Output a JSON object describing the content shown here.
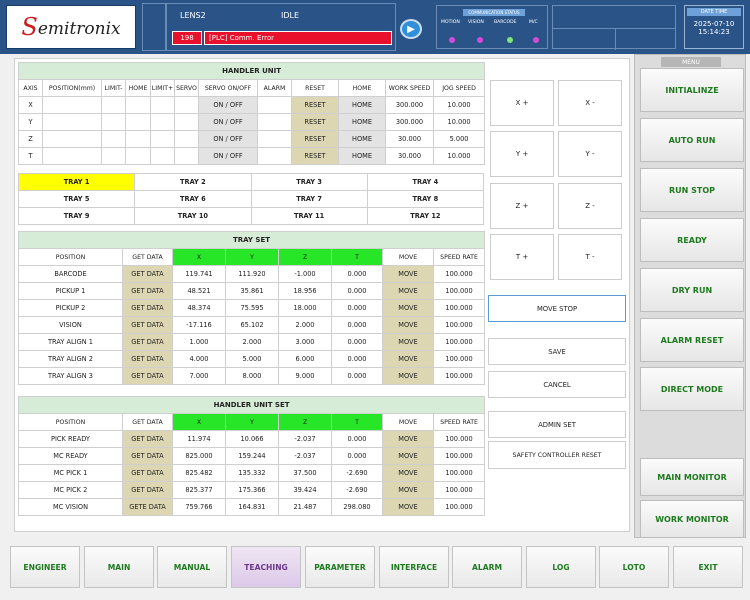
{
  "header": {
    "logo_text": "Semitronix",
    "lens": "LENS2",
    "state": "IDLE",
    "error_code": "198",
    "error_message": "[PLC] Comm. Error",
    "comm_title": "COMMUNICATION STATUS",
    "comm_items": [
      {
        "label": "MOTION",
        "color": "#d84bd8"
      },
      {
        "label": "VISION",
        "color": "#d84bd8"
      },
      {
        "label": "BARCODE",
        "color": "#7fe37f"
      },
      {
        "label": "M/C",
        "color": "#d84bd8"
      }
    ],
    "datetime_title": "DATE TIME",
    "date": "2025-07-10",
    "time": "15:14:23"
  },
  "handler_unit": {
    "title": "HANDLER UNIT",
    "columns": [
      "AXIS",
      "POSITION(mm)",
      "LIMIT-",
      "HOME",
      "LIMIT+",
      "SERVO",
      "SERVO ON/OFF",
      "ALARM",
      "RESET",
      "HOME",
      "WORK SPEED",
      "JOG SPEED"
    ],
    "rows": [
      {
        "axis": "X",
        "servo": "ON / OFF",
        "reset": "RESET",
        "home": "HOME",
        "work": "300.000",
        "jog": "10.000"
      },
      {
        "axis": "Y",
        "servo": "ON / OFF",
        "reset": "RESET",
        "home": "HOME",
        "work": "300.000",
        "jog": "10.000"
      },
      {
        "axis": "Z",
        "servo": "ON / OFF",
        "reset": "RESET",
        "home": "HOME",
        "work": "30.000",
        "jog": "5.000"
      },
      {
        "axis": "T",
        "servo": "ON / OFF",
        "reset": "RESET",
        "home": "HOME",
        "work": "30.000",
        "jog": "10.000"
      }
    ]
  },
  "trays": [
    "TRAY 1",
    "TRAY 2",
    "TRAY 3",
    "TRAY 4",
    "TRAY 5",
    "TRAY 6",
    "TRAY 7",
    "TRAY 8",
    "TRAY 9",
    "TRAY 10",
    "TRAY 11",
    "TRAY 12"
  ],
  "tray_set": {
    "title": "TRAY SET",
    "columns": [
      "POSITION",
      "GET DATA",
      "X",
      "Y",
      "Z",
      "T",
      "MOVE",
      "SPEED RATE"
    ],
    "rows": [
      {
        "pos": "BARCODE",
        "get": "GET DATA",
        "x": "119.741",
        "y": "111.920",
        "z": "-1.000",
        "t": "0.000",
        "move": "MOVE",
        "speed": "100.000"
      },
      {
        "pos": "PICKUP 1",
        "get": "GET DATA",
        "x": "48.521",
        "y": "35.861",
        "z": "18.956",
        "t": "0.000",
        "move": "MOVE",
        "speed": "100.000"
      },
      {
        "pos": "PICKUP 2",
        "get": "GET DATA",
        "x": "48.374",
        "y": "75.595",
        "z": "18.000",
        "t": "0.000",
        "move": "MOVE",
        "speed": "100.000"
      },
      {
        "pos": "VISION",
        "get": "GET DATA",
        "x": "-17.116",
        "y": "65.102",
        "z": "2.000",
        "t": "0.000",
        "move": "MOVE",
        "speed": "100.000"
      },
      {
        "pos": "TRAY ALIGN 1",
        "get": "GET DATA",
        "x": "1.000",
        "y": "2.000",
        "z": "3.000",
        "t": "0.000",
        "move": "MOVE",
        "speed": "100.000"
      },
      {
        "pos": "TRAY ALIGN 2",
        "get": "GET DATA",
        "x": "4.000",
        "y": "5.000",
        "z": "6.000",
        "t": "0.000",
        "move": "MOVE",
        "speed": "100.000"
      },
      {
        "pos": "TRAY ALIGN 3",
        "get": "GET DATA",
        "x": "7.000",
        "y": "8.000",
        "z": "9.000",
        "t": "0.000",
        "move": "MOVE",
        "speed": "100.000"
      }
    ]
  },
  "handler_unit_set": {
    "title": "HANDLER UNIT SET",
    "columns": [
      "POSITION",
      "GET DATA",
      "X",
      "Y",
      "Z",
      "T",
      "MOVE",
      "SPEED RATE"
    ],
    "rows": [
      {
        "pos": "PICK READY",
        "get": "GET DATA",
        "x": "11.974",
        "y": "10.066",
        "z": "-2.037",
        "t": "0.000",
        "move": "MOVE",
        "speed": "100.000"
      },
      {
        "pos": "MC READY",
        "get": "GET DATA",
        "x": "825.000",
        "y": "159.244",
        "z": "-2.037",
        "t": "0.000",
        "move": "MOVE",
        "speed": "100.000"
      },
      {
        "pos": "MC PICK 1",
        "get": "GET DATA",
        "x": "825.482",
        "y": "135.332",
        "z": "37.500",
        "t": "-2.690",
        "move": "MOVE",
        "speed": "100.000"
      },
      {
        "pos": "MC PICK 2",
        "get": "GET DATA",
        "x": "825.377",
        "y": "175.366",
        "z": "39.424",
        "t": "-2.690",
        "move": "MOVE",
        "speed": "100.000"
      },
      {
        "pos": "MC VISION",
        "get": "GETE DATA",
        "x": "759.766",
        "y": "164.831",
        "z": "21.487",
        "t": "298.080",
        "move": "MOVE",
        "speed": "100.000"
      }
    ]
  },
  "jog": [
    "X +",
    "X -",
    "Y +",
    "Y -",
    "Z +",
    "Z -",
    "T +",
    "T -"
  ],
  "actions": {
    "move_stop": "MOVE STOP",
    "save": "SAVE",
    "cancel": "CANCEL",
    "admin_set": "ADMIN SET",
    "safety_reset": "SAFETY CONTROLLER RESET"
  },
  "menu": {
    "label": "MENU",
    "items": [
      "INITIALINZE",
      "AUTO RUN",
      "RUN STOP",
      "READY",
      "DRY RUN",
      "ALARM RESET",
      "DIRECT MODE",
      "MAIN MONITOR",
      "WORK MONITOR"
    ]
  },
  "nav": {
    "items": [
      "ENGINEER",
      "MAIN",
      "MANUAL",
      "TEACHING",
      "PARAMETER",
      "INTERFACE",
      "ALARM",
      "LOG",
      "LOTO",
      "EXIT"
    ],
    "active": "TEACHING"
  }
}
